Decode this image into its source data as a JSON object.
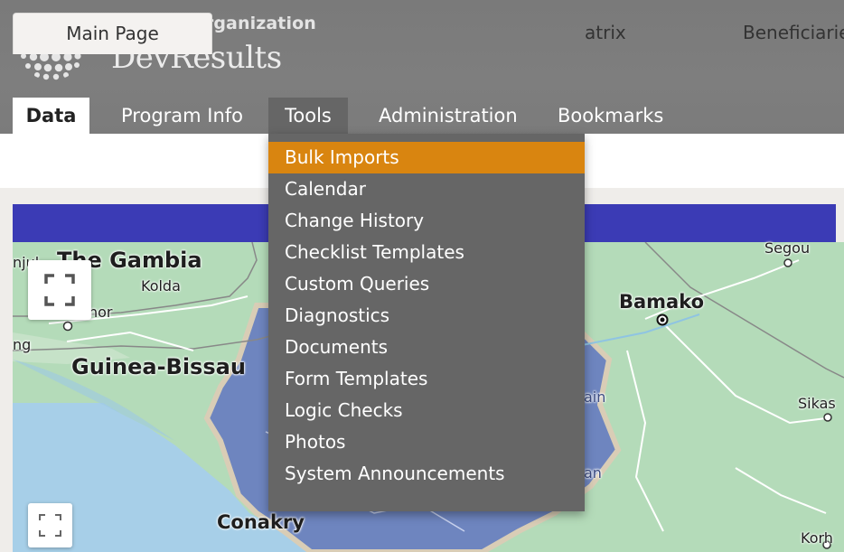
{
  "header": {
    "org_name": "Sample Organization",
    "app_name": "DevResults"
  },
  "topnav": {
    "tabs": [
      {
        "label": "Data",
        "state": "active"
      },
      {
        "label": "Program Info"
      },
      {
        "label": "Tools",
        "state": "open"
      },
      {
        "label": "Administration"
      },
      {
        "label": "Bookmarks"
      }
    ]
  },
  "subnav": {
    "tabs": [
      {
        "label": "Main Page",
        "state": "active"
      },
      {
        "label": "atrix"
      },
      {
        "label": "Beneficiarie"
      }
    ]
  },
  "tools_menu": {
    "items": [
      {
        "label": "Bulk Imports",
        "state": "hover"
      },
      {
        "label": "Calendar"
      },
      {
        "label": "Change History"
      },
      {
        "label": "Checklist Templates"
      },
      {
        "label": "Custom Queries"
      },
      {
        "label": "Diagnostics"
      },
      {
        "label": "Documents"
      },
      {
        "label": "Form Templates"
      },
      {
        "label": "Logic Checks"
      },
      {
        "label": "Photos"
      },
      {
        "label": "System Announcements"
      }
    ]
  },
  "map": {
    "labels": {
      "gambia": "The Gambia",
      "banjul": "njul",
      "kolda": "Kolda",
      "nor": "nor",
      "ng": "ng",
      "guinea_bissau": "Guinea-Bissau",
      "conakry": "Conakry",
      "bamako": "Bamako",
      "segou": "Segou",
      "sikasso": "Sikas",
      "korh": "Korh",
      "ain": "ain",
      "an": "an"
    }
  },
  "colors": {
    "header_bg": "#7b7b7b",
    "menu_bg": "#666666",
    "menu_hover": "#d98510",
    "banner": "#3b3bb5",
    "land": "#b4dbb9",
    "water": "#a7cfe8",
    "region": "#6e85bf"
  }
}
